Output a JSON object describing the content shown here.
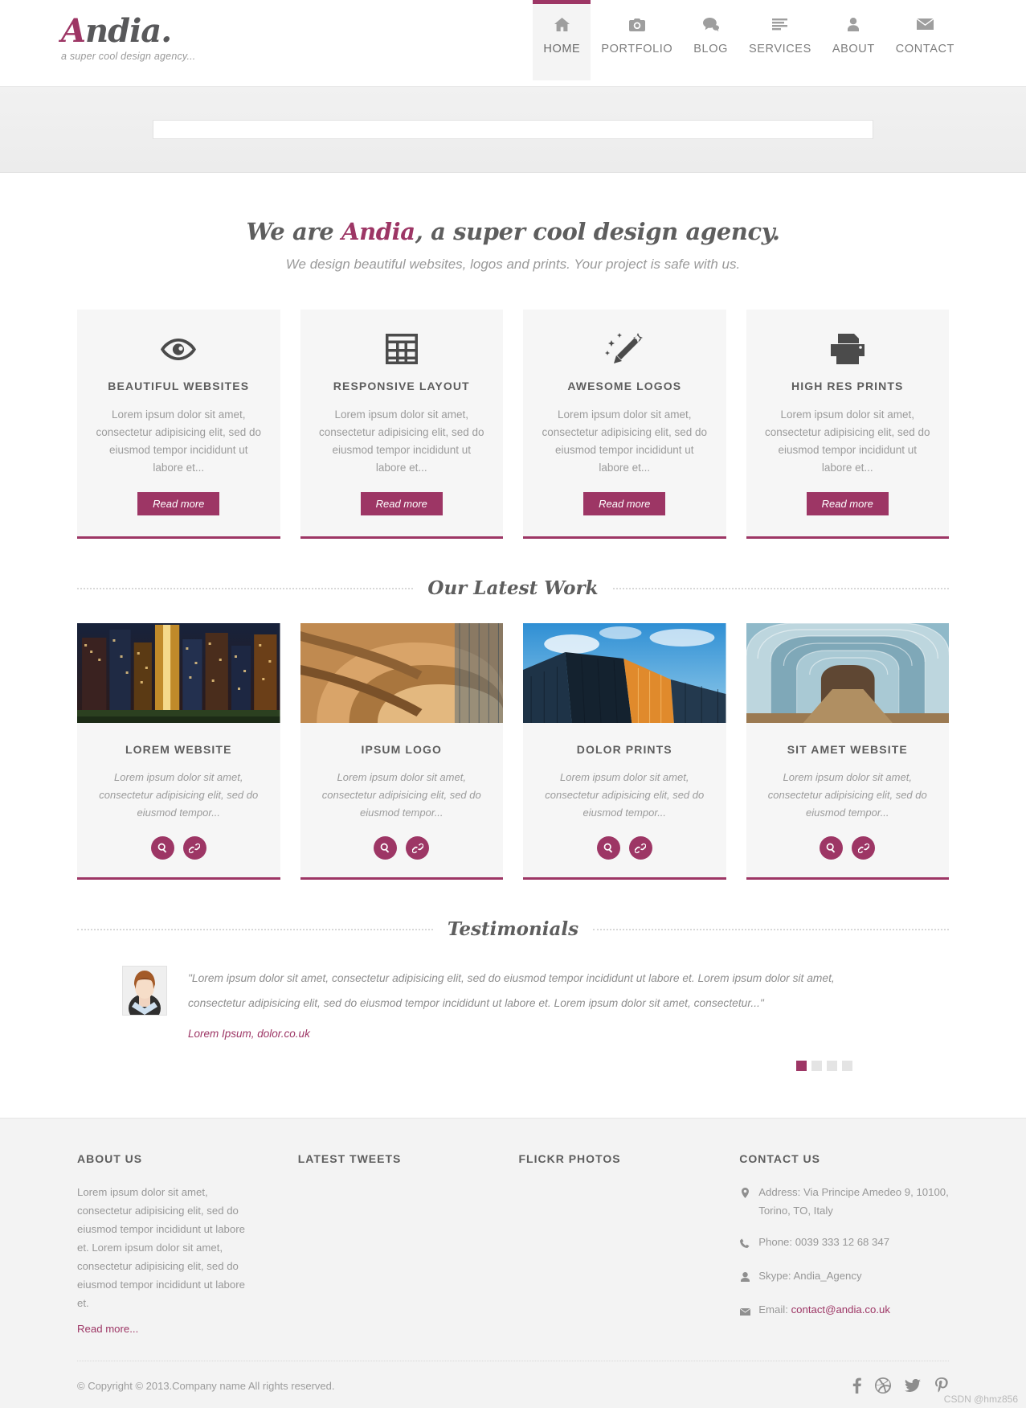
{
  "brand": {
    "logo_accent": "A",
    "logo_rest": "ndia.",
    "tagline": "a super cool design agency..."
  },
  "nav": {
    "items": [
      {
        "label": "HOME",
        "icon": "home-icon",
        "active": true
      },
      {
        "label": "PORTFOLIO",
        "icon": "camera-icon",
        "active": false
      },
      {
        "label": "BLOG",
        "icon": "chat-bubble-icon",
        "active": false
      },
      {
        "label": "SERVICES",
        "icon": "list-lines-icon",
        "active": false
      },
      {
        "label": "ABOUT",
        "icon": "person-icon",
        "active": false
      },
      {
        "label": "CONTACT",
        "icon": "envelope-icon",
        "active": false
      }
    ]
  },
  "intro": {
    "title_pre": "We are ",
    "title_accent": "Andia",
    "title_post": ", a super cool design agency.",
    "subtitle": "We design beautiful websites, logos and prints. Your project is safe with us."
  },
  "services": {
    "read_more_label": "Read more",
    "items": [
      {
        "icon": "eye-icon",
        "title": "BEAUTIFUL WEBSITES",
        "text": "Lorem ipsum dolor sit amet, consectetur adipisicing elit, sed do eiusmod tempor incididunt ut labore et..."
      },
      {
        "icon": "grid-table-icon",
        "title": "RESPONSIVE LAYOUT",
        "text": "Lorem ipsum dolor sit amet, consectetur adipisicing elit, sed do eiusmod tempor incididunt ut labore et..."
      },
      {
        "icon": "magic-wand-icon",
        "title": "AWESOME LOGOS",
        "text": "Lorem ipsum dolor sit amet, consectetur adipisicing elit, sed do eiusmod tempor incididunt ut labore et..."
      },
      {
        "icon": "printer-icon",
        "title": "HIGH RES PRINTS",
        "text": "Lorem ipsum dolor sit amet, consectetur adipisicing elit, sed do eiusmod tempor incididunt ut labore et..."
      }
    ]
  },
  "latest_work": {
    "heading": "Our Latest Work",
    "items": [
      {
        "title": "LOREM WEBSITE",
        "text": "Lorem ipsum dolor sit amet, consectetur adipisicing elit, sed do eiusmod tempor...",
        "thumb": "city-skyscrapers-night",
        "zoom_icon": "magnifier-icon",
        "link_icon": "link-chain-icon"
      },
      {
        "title": "IPSUM LOGO",
        "text": "Lorem ipsum dolor sit amet, consectetur adipisicing elit, sed do eiusmod tempor...",
        "thumb": "spiral-staircase",
        "zoom_icon": "magnifier-icon",
        "link_icon": "link-chain-icon"
      },
      {
        "title": "DOLOR PRINTS",
        "text": "Lorem ipsum dolor sit amet, consectetur adipisicing elit, sed do eiusmod tempor...",
        "thumb": "glass-building-blue-sky",
        "zoom_icon": "magnifier-icon",
        "link_icon": "link-chain-icon"
      },
      {
        "title": "SIT AMET WEBSITE",
        "text": "Lorem ipsum dolor sit amet, consectetur adipisicing elit, sed do eiusmod tempor...",
        "thumb": "glass-tunnel-corridor",
        "zoom_icon": "magnifier-icon",
        "link_icon": "link-chain-icon"
      }
    ]
  },
  "testimonials": {
    "heading": "Testimonials",
    "quote": "\"Lorem ipsum dolor sit amet, consectetur adipisicing elit, sed do eiusmod tempor incididunt ut labore et. Lorem ipsum dolor sit amet, consectetur adipisicing elit, sed do eiusmod tempor incididunt ut labore et. Lorem ipsum dolor sit amet, consectetur...\"",
    "cite": "Lorem Ipsum, dolor.co.uk",
    "avatar": "user-avatar",
    "pager": [
      {
        "active": true
      },
      {
        "active": false
      },
      {
        "active": false
      },
      {
        "active": false
      }
    ]
  },
  "footer": {
    "about": {
      "heading": "ABOUT US",
      "text": "Lorem ipsum dolor sit amet, consectetur adipisicing elit, sed do eiusmod tempor incididunt ut labore et. Lorem ipsum dolor sit amet, consectetur adipisicing elit, sed do eiusmod tempor incididunt ut labore et.",
      "link": "Read more..."
    },
    "tweets": {
      "heading": "LATEST TWEETS"
    },
    "flickr": {
      "heading": "FLICKR PHOTOS"
    },
    "contact": {
      "heading": "CONTACT US",
      "address_label": "Address: Via Principe Amedeo 9, 10100, Torino, TO, Italy",
      "phone_label": "Phone: 0039 333 12 68 347",
      "skype_label": "Skype: Andia_Agency",
      "email_prefix": "Email: ",
      "email": "contact@andia.co.uk"
    },
    "copyright": "© Copyright © 2013.Company name All rights reserved.",
    "socials": [
      {
        "name": "facebook-icon"
      },
      {
        "name": "dribbble-icon"
      },
      {
        "name": "twitter-icon"
      },
      {
        "name": "pinterest-icon"
      }
    ]
  },
  "watermark": "CSDN @hmz856",
  "colors": {
    "accent": "#9d3665",
    "text_dark": "#5d5d5d",
    "text_muted": "#9b9b9b",
    "panel": "#f6f6f6"
  }
}
